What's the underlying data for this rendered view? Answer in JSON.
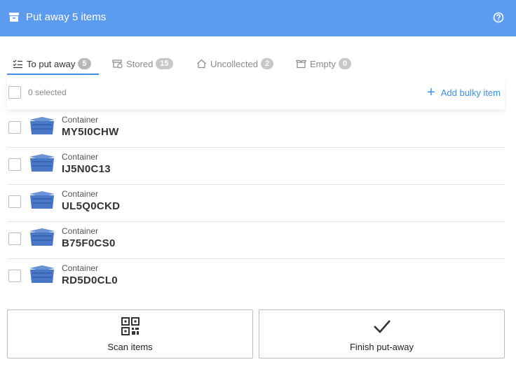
{
  "header": {
    "title": "Put away 5 items",
    "bg_color": "#5b9bf0"
  },
  "tabs": [
    {
      "label": "To put away",
      "count": "5",
      "active": true,
      "icon": "checklist-icon"
    },
    {
      "label": "Stored",
      "count": "15",
      "active": false,
      "icon": "stored-box-icon"
    },
    {
      "label": "Uncollected",
      "count": "2",
      "active": false,
      "icon": "home-icon"
    },
    {
      "label": "Empty",
      "count": "0",
      "active": false,
      "icon": "open-box-icon"
    }
  ],
  "selection": {
    "count_label": "0 selected",
    "add_bulky_label": "Add bulky item"
  },
  "items": [
    {
      "type": "Container",
      "code": "MY5I0CHW"
    },
    {
      "type": "Container",
      "code": "IJ5N0C13"
    },
    {
      "type": "Container",
      "code": "UL5Q0CKD"
    },
    {
      "type": "Container",
      "code": "B75F0CS0"
    },
    {
      "type": "Container",
      "code": "RD5D0CL0"
    }
  ],
  "actions": {
    "scan_label": "Scan items",
    "finish_label": "Finish put-away"
  },
  "colors": {
    "accent": "#3e8fe6",
    "crate": "#4a78c8"
  }
}
